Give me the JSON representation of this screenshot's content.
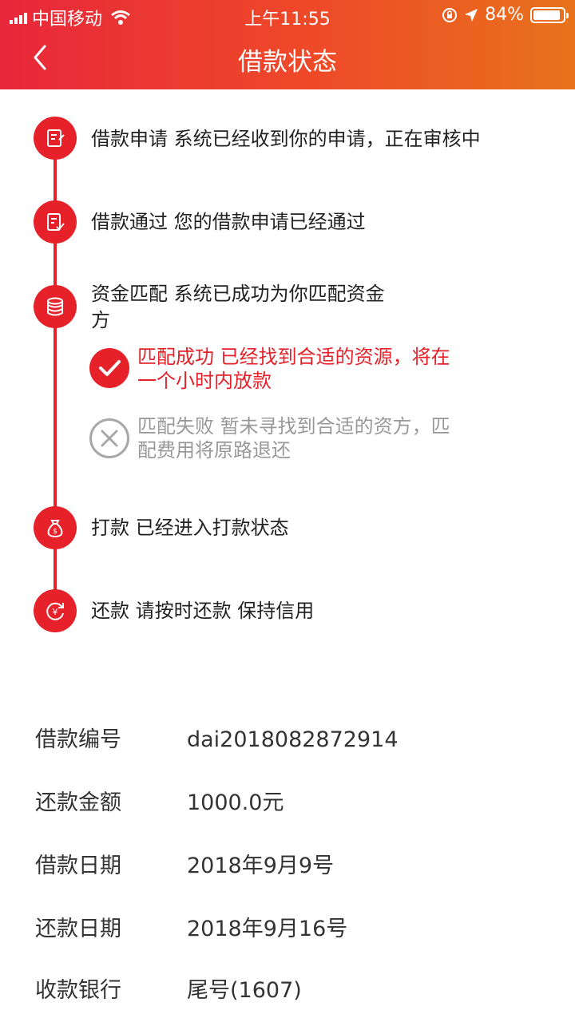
{
  "status_bar": {
    "carrier": "中国移动",
    "time": "上午11:55",
    "battery": "84%",
    "battery_level": 0.84
  },
  "nav": {
    "title": "借款状态"
  },
  "steps": [
    {
      "text": "借款申请  系统已经收到你的申请，正在审核中",
      "icon": "edit-document-icon"
    },
    {
      "text": "借款通过  您的借款申请已经通过",
      "icon": "document-check-icon"
    },
    {
      "text_line1": "资金匹配 系统已成功为你匹配资金",
      "text_line2": "方",
      "icon": "coins-icon"
    },
    {
      "text": "打款 已经进入打款状态",
      "icon": "money-bag-icon"
    },
    {
      "text": "还款 请按时还款 保持信用",
      "icon": "yuan-refresh-icon"
    }
  ],
  "match_results": {
    "success": {
      "line1": "匹配成功 已经找到合适的资源，将在",
      "line2": "一个小时内放款",
      "color": "#e62129"
    },
    "failure": {
      "line1": "匹配失败 暂未寻找到合适的资方，匹",
      "line2": "配费用将原路退还",
      "color": "#999999"
    }
  },
  "info": [
    {
      "label": "借款编号",
      "value": "dai2018082872914"
    },
    {
      "label": "还款金额",
      "value": "1000.0元"
    },
    {
      "label": "借款日期",
      "value": "2018年9月9号"
    },
    {
      "label": "还款日期",
      "value": "2018年9月16号"
    },
    {
      "label": "收款银行",
      "value": "尾号(1607)"
    }
  ],
  "colors": {
    "accent": "#e62129",
    "header_start": "#e8273b",
    "header_end": "#e8731c"
  }
}
